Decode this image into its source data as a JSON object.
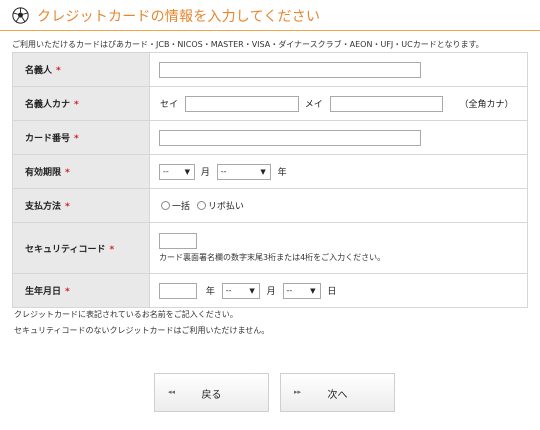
{
  "header": {
    "title": "クレジットカードの情報を入力してください",
    "icon": "soccer-ball-icon",
    "accent_color": "#e8862e"
  },
  "notice": "ご利用いただけるカードはぴあカード・JCB・NICOS・MASTER・VISA・ダイナースクラブ・AEON・UFJ・UCカードとなります。",
  "required_mark": "*",
  "rows": {
    "holder": {
      "label": "名義人",
      "value": ""
    },
    "holder_kana": {
      "label": "名義人カナ",
      "sei_label": "セイ",
      "mei_label": "メイ",
      "note": "（全角カナ）",
      "sei_value": "",
      "mei_value": ""
    },
    "card_number": {
      "label": "カード番号",
      "value": ""
    },
    "expiry": {
      "label": "有効期限",
      "month_value": "--",
      "month_unit": "月",
      "year_value": "--",
      "year_unit": "年"
    },
    "payment": {
      "label": "支払方法",
      "options": [
        "一括",
        "リボ払い"
      ]
    },
    "security": {
      "label": "セキュリティコード",
      "value": "",
      "hint": "カード裏面署名欄の数字末尾3桁または4桁をご入力ください。"
    },
    "birth": {
      "label": "生年月日",
      "year_value": "",
      "year_unit": "年",
      "month_value": "--",
      "month_unit": "月",
      "day_value": "--",
      "day_unit": "日"
    }
  },
  "notes": [
    "クレジットカードに表記されているお名前をご記入ください。",
    "セキュリティコードのないクレジットカードはご利用いただけません。"
  ],
  "buttons": {
    "back": {
      "label": "戻る",
      "icon": "double-chevron-left-icon"
    },
    "next": {
      "label": "次へ",
      "icon": "double-chevron-right-icon"
    }
  }
}
